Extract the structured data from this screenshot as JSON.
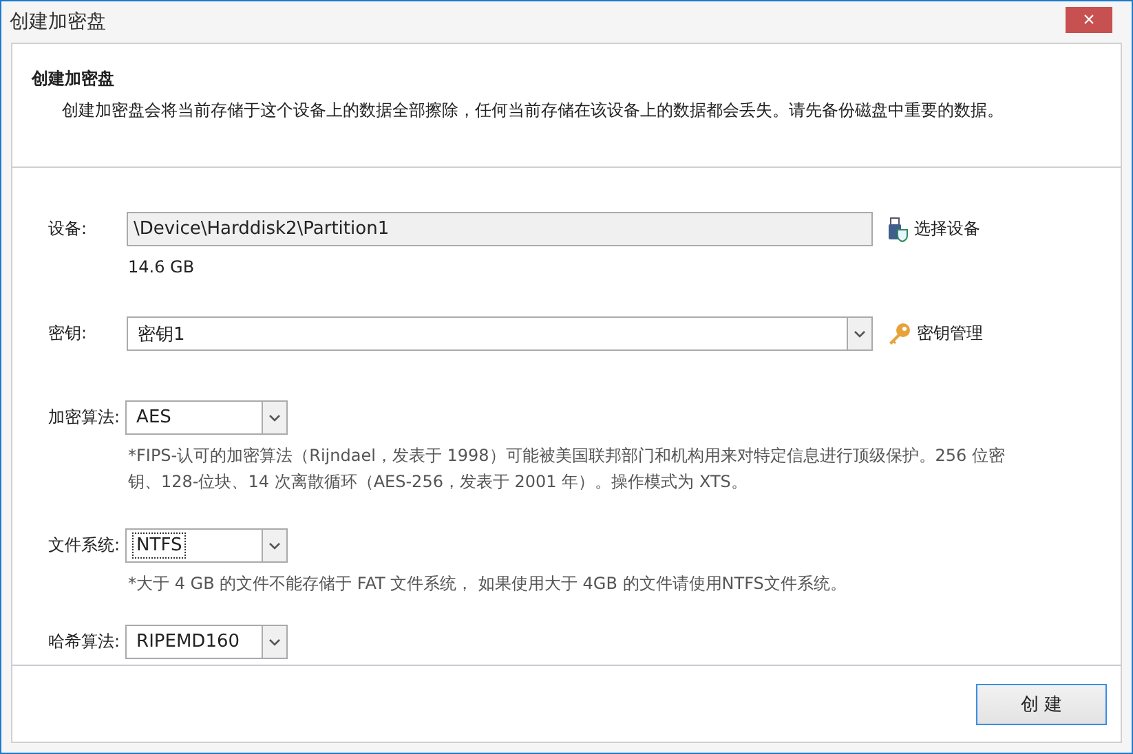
{
  "window": {
    "title": "创建加密盘",
    "close": "×"
  },
  "header": {
    "title": "创建加密盘",
    "description": "创建加密盘会将当前存储于这个设备上的数据全部擦除，任何当前存储在该设备上的数据都会丢失。请先备份磁盘中重要的数据。"
  },
  "device": {
    "label": "设备:",
    "value": "\\Device\\Harddisk2\\Partition1",
    "size": "14.6 GB",
    "action": "选择设备"
  },
  "key": {
    "label": "密钥:",
    "value": "密钥1",
    "action": "密钥管理"
  },
  "algorithm": {
    "label": "加密算法:",
    "value": "AES",
    "focused": false,
    "note": "*FIPS-认可的加密算法（Rijndael，发表于 1998）可能被美国联邦部门和机构用来对特定信息进行顶级保护。256 位密钥、128-位块、14 次离散循环（AES-256，发表于 2001 年）。操作模式为 XTS。"
  },
  "filesystem": {
    "label": "文件系统:",
    "value": "NTFS",
    "focused": true,
    "note": "*大于 4 GB 的文件不能存储于 FAT 文件系统， 如果使用大于 4GB 的文件请使用NTFS文件系统。"
  },
  "hash": {
    "label": "哈希算法:",
    "value": "RIPEMD160",
    "focused": false
  },
  "buttons": [
    {
      "label": "创 建",
      "default": true
    }
  ]
}
